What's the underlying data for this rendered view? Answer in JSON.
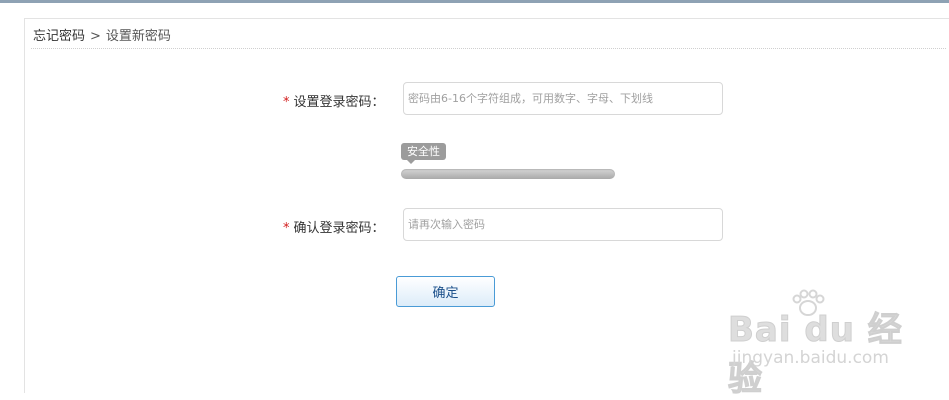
{
  "breadcrumb": {
    "parent": "忘记密码",
    "separator": ">",
    "current": "设置新密码"
  },
  "form": {
    "password": {
      "required_mark": "*",
      "label": "设置登录密码：",
      "value": "",
      "placeholder": "密码由6-16个字符组成，可用数字、字母、下划线"
    },
    "strength": {
      "label": "安全性",
      "level": 0
    },
    "confirm": {
      "required_mark": "*",
      "label": "确认登录密码：",
      "value": "",
      "placeholder": "请再次输入密码"
    },
    "submit_label": "确定"
  },
  "watermark": {
    "logo_text": "Bai du 经验",
    "url": "jingyan.baidu.com"
  },
  "colors": {
    "required": "#d21b1b",
    "button_border": "#4a9bd6",
    "button_text": "#1a4f8a",
    "strength_tag": "#9c9c9c"
  },
  "icons": {
    "watermark_paw": "paw-icon"
  }
}
